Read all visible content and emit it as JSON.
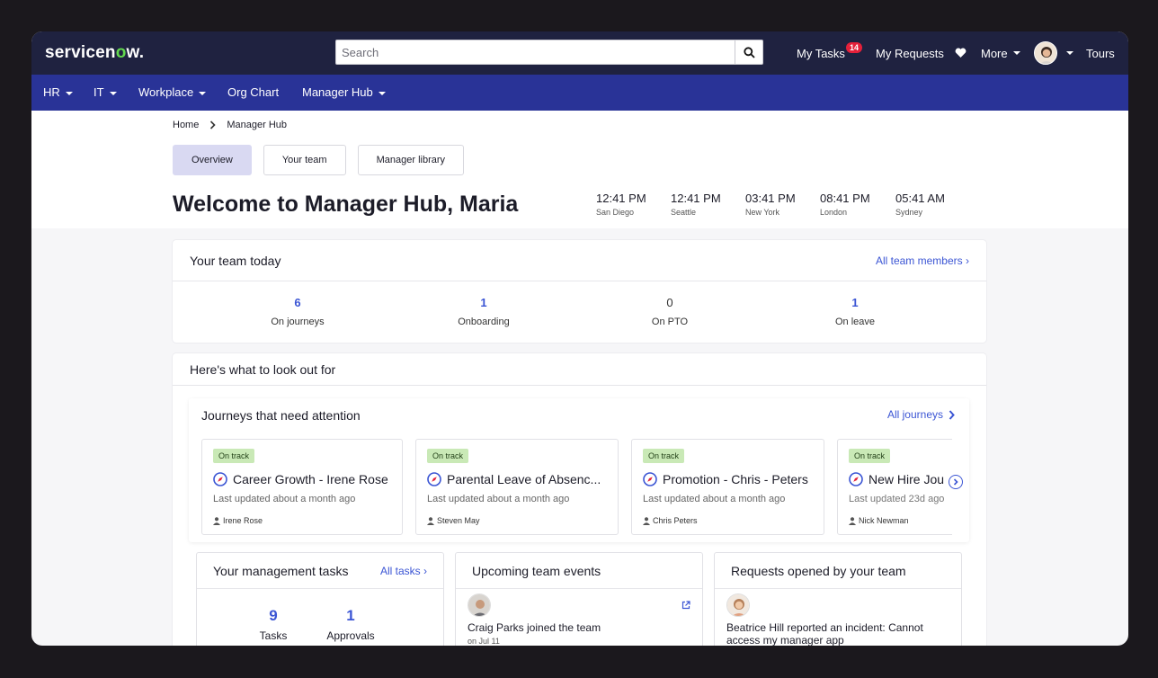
{
  "header": {
    "logo_text": "servicen",
    "logo_accent": "o",
    "logo_end": "w.",
    "search_placeholder": "Search",
    "my_tasks": "My Tasks",
    "tasks_badge": "14",
    "my_requests": "My Requests",
    "more": "More",
    "tours": "Tours"
  },
  "nav": {
    "items": [
      "HR",
      "IT",
      "Workplace",
      "Org Chart",
      "Manager Hub"
    ]
  },
  "breadcrumb": [
    "Home",
    "Manager Hub"
  ],
  "tabs": [
    "Overview",
    "Your team",
    "Manager library"
  ],
  "welcome": "Welcome to Manager Hub, Maria",
  "clocks": [
    {
      "time": "12:41 PM",
      "city": "San Diego"
    },
    {
      "time": "12:41 PM",
      "city": "Seattle"
    },
    {
      "time": "03:41 PM",
      "city": "New York"
    },
    {
      "time": "08:41 PM",
      "city": "London"
    },
    {
      "time": "05:41 AM",
      "city": "Sydney"
    }
  ],
  "team_today": {
    "title": "Your team today",
    "link": "All team members",
    "stats": [
      {
        "value": "6",
        "label": "On journeys"
      },
      {
        "value": "1",
        "label": "Onboarding"
      },
      {
        "value": "0",
        "label": "On PTO"
      },
      {
        "value": "1",
        "label": "On leave"
      }
    ]
  },
  "lookout": {
    "title": "Here's what to look out for",
    "journeys_title": "Journeys that need attention",
    "journeys_link": "All journeys",
    "journeys": [
      {
        "status": "On track",
        "title": "Career Growth - Irene Rose",
        "updated": "Last updated about a month ago",
        "person": "Irene Rose"
      },
      {
        "status": "On track",
        "title": "Parental Leave of Absenc...",
        "updated": "Last updated about a month ago",
        "person": "Steven May"
      },
      {
        "status": "On track",
        "title": "Promotion - Chris - Peters",
        "updated": "Last updated about a month ago",
        "person": "Chris Peters"
      },
      {
        "status": "On track",
        "title": "New Hire Jou",
        "updated": "Last updated 23d ago",
        "person": "Nick Newman"
      }
    ]
  },
  "mgmt_tasks": {
    "title": "Your management tasks",
    "link": "All tasks",
    "tasks_value": "9",
    "tasks_label": "Tasks",
    "approvals_value": "1",
    "approvals_label": "Approvals"
  },
  "events": {
    "title": "Upcoming team events",
    "item_text": "Craig Parks joined the team",
    "item_date": "on Jul 11"
  },
  "requests": {
    "title": "Requests opened by your team",
    "item_text": "Beatrice Hill reported an incident: Cannot access my manager app"
  },
  "colors": {
    "header_bg": "#1f2240",
    "nav_bg": "#293397",
    "accent": "#3b55d4",
    "badge": "#e5203a",
    "status_pill": "#c9e9b6",
    "tab_active": "#d9d9f2"
  }
}
